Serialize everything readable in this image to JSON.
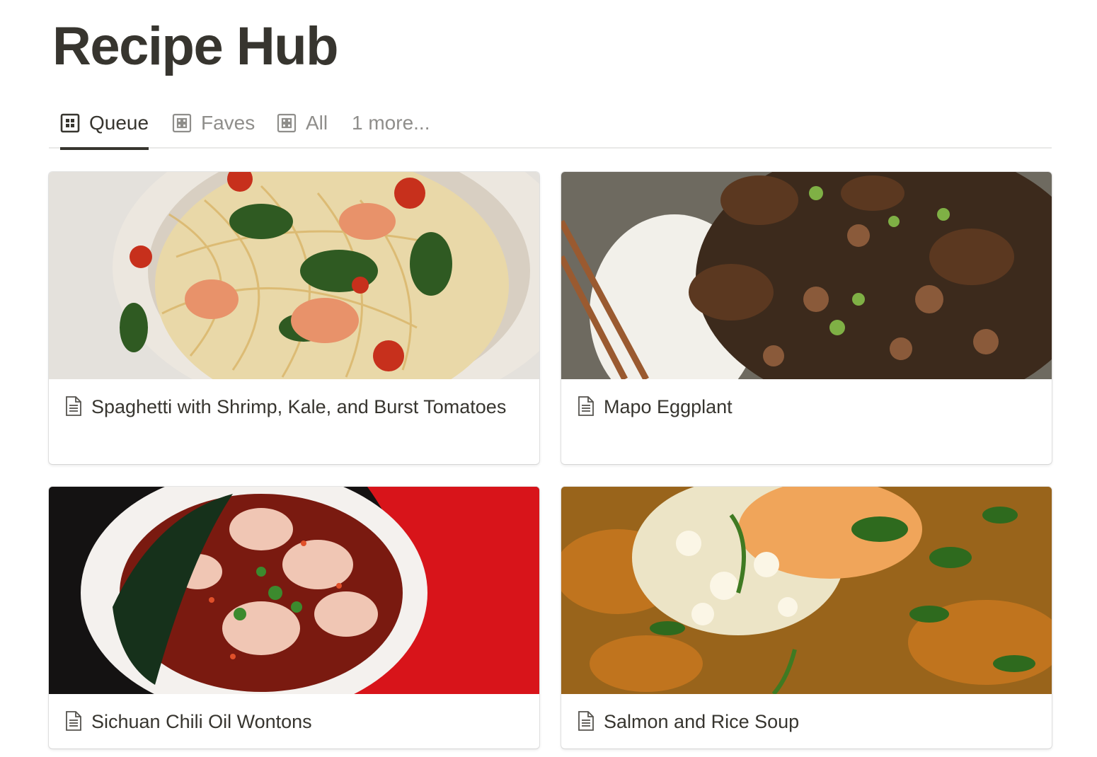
{
  "page": {
    "title": "Recipe Hub"
  },
  "tabs": [
    {
      "label": "Queue",
      "icon": "gallery-icon",
      "active": true
    },
    {
      "label": "Faves",
      "icon": "gallery-icon",
      "active": false
    },
    {
      "label": "All",
      "icon": "gallery-icon",
      "active": false
    },
    {
      "label": "1 more...",
      "icon": null,
      "active": false
    }
  ],
  "cards": [
    {
      "title": "Spaghetti with Shrimp, Kale, and Burst Tomatoes",
      "icon": "page-icon",
      "cover": "spaghetti-shrimp-photo"
    },
    {
      "title": "Mapo Eggplant",
      "icon": "page-icon",
      "cover": "mapo-eggplant-photo"
    },
    {
      "title": "Sichuan Chili Oil Wontons",
      "icon": "page-icon",
      "cover": "chili-oil-wontons-photo"
    },
    {
      "title": "Salmon and Rice Soup",
      "icon": "page-icon",
      "cover": "salmon-rice-soup-photo"
    }
  ],
  "colors": {
    "text": "#37352f",
    "muted": "#8f8e8b",
    "divider": "#e9e9e7"
  }
}
